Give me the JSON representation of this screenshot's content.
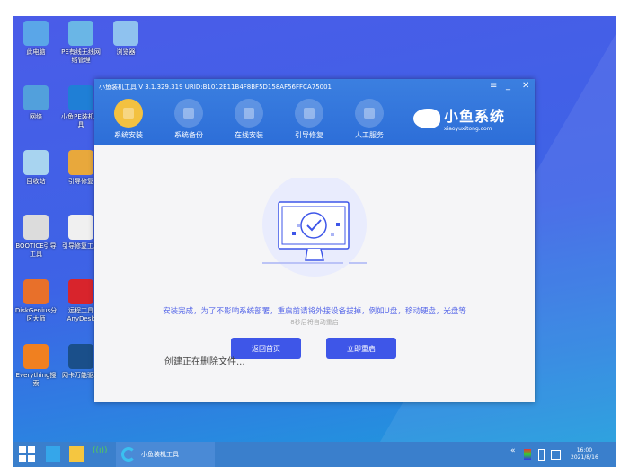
{
  "desktop": {
    "icons": [
      {
        "label": "此电脑",
        "color": "#5aa6e8"
      },
      {
        "label": "PE有线无线网络管理",
        "color": "#6ab6e6"
      },
      {
        "label": "浏览器",
        "color": "#8fc2ef"
      },
      {
        "label": "网络",
        "color": "#52a0dc"
      },
      {
        "label": "小鱼PE装机工具",
        "color": "#1f7fd6"
      },
      {
        "label": "回收站",
        "color": "#a8d4f0"
      },
      {
        "label": "引导修复",
        "color": "#e8a83c"
      },
      {
        "label": "BOOTICE引导工具",
        "color": "#dcdcdc"
      },
      {
        "label": "引导修复工具",
        "color": "#f0f0f0"
      },
      {
        "label": "DiskGenius分区大师",
        "color": "#e8702a"
      },
      {
        "label": "远程工具AnyDesk",
        "color": "#d8242c"
      },
      {
        "label": "Everything搜索",
        "color": "#f08020"
      },
      {
        "label": "网卡万能驱动",
        "color": "#1a4f8a"
      }
    ]
  },
  "window": {
    "title": "小鱼装机工具 V 3.1.329.319 URID:B1012E11B4F8BF5D158AF56FFCA75001",
    "nav": [
      {
        "label": "系统安装"
      },
      {
        "label": "系统备份"
      },
      {
        "label": "在线安装"
      },
      {
        "label": "引导修复"
      },
      {
        "label": "人工服务"
      }
    ],
    "logo": {
      "name": "小鱼系统",
      "url": "xiaoyuxitong.com"
    },
    "message": "安装完成，为了不影响系统部署，重启前请将外接设备拔掉，例如U盘，移动硬盘，光盘等",
    "countdown": "8秒后将自动重启",
    "back_button": "返回首页",
    "restart_button": "立即重启",
    "overlay_text": "创建正在删除文件..."
  },
  "taskbar": {
    "app_label": "小鱼装机工具",
    "time": "16:00",
    "date": "2021/8/16"
  }
}
